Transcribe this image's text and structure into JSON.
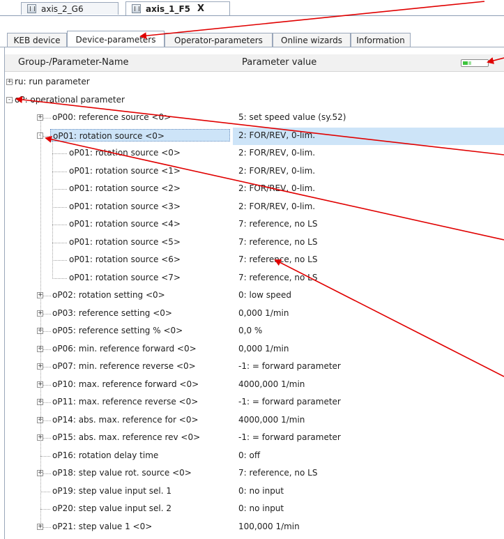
{
  "doc_tabs": [
    {
      "label": "axis_2_G6",
      "active": false
    },
    {
      "label": "axis_1_F5",
      "active": true,
      "close": "X"
    }
  ],
  "sub_tabs": [
    {
      "label": "KEB device",
      "active": false
    },
    {
      "label": "Device-parameters",
      "active": true
    },
    {
      "label": "Operator-parameters",
      "active": false
    },
    {
      "label": "Online wizards",
      "active": false
    },
    {
      "label": "Information",
      "active": false
    }
  ],
  "columns": {
    "name": "Group-/Parameter-Name",
    "value": "Parameter value"
  },
  "rows": [
    {
      "name": "ru: run parameter",
      "value": "",
      "level": 0,
      "expander": "+"
    },
    {
      "name": "oP: operational parameter",
      "value": "",
      "level": 0,
      "expander": "-"
    },
    {
      "name": "oP00: reference source <0>",
      "value": "5: set speed value (sy.52)",
      "level": 1,
      "expander": "+"
    },
    {
      "name": "oP01: rotation source <0>",
      "value": "2: FOR/REV, 0-lim.",
      "level": 1,
      "expander": "-",
      "selected": true
    },
    {
      "name": "oP01: rotation source <0>",
      "value": "2: FOR/REV, 0-lim.",
      "level": 2,
      "expander": ""
    },
    {
      "name": "oP01: rotation source <1>",
      "value": "2: FOR/REV, 0-lim.",
      "level": 2,
      "expander": ""
    },
    {
      "name": "oP01: rotation source <2>",
      "value": "2: FOR/REV, 0-lim.",
      "level": 2,
      "expander": ""
    },
    {
      "name": "oP01: rotation source <3>",
      "value": "2: FOR/REV, 0-lim.",
      "level": 2,
      "expander": ""
    },
    {
      "name": "oP01: rotation source <4>",
      "value": "7: reference, no LS",
      "level": 2,
      "expander": ""
    },
    {
      "name": "oP01: rotation source <5>",
      "value": "7: reference, no LS",
      "level": 2,
      "expander": ""
    },
    {
      "name": "oP01: rotation source <6>",
      "value": "7: reference, no LS",
      "level": 2,
      "expander": ""
    },
    {
      "name": "oP01: rotation source <7>",
      "value": "7: reference, no LS",
      "level": 2,
      "expander": ""
    },
    {
      "name": "oP02: rotation setting <0>",
      "value": "0: low speed",
      "level": 1,
      "expander": "+"
    },
    {
      "name": "oP03: reference setting <0>",
      "value": "0,000 1/min",
      "level": 1,
      "expander": "+"
    },
    {
      "name": "oP05: reference setting % <0>",
      "value": "0,0 %",
      "level": 1,
      "expander": "+"
    },
    {
      "name": "oP06: min. reference forward <0>",
      "value": "0,000 1/min",
      "level": 1,
      "expander": "+"
    },
    {
      "name": "oP07: min. reference reverse <0>",
      "value": "-1: = forward parameter",
      "level": 1,
      "expander": "+"
    },
    {
      "name": "oP10: max. reference forward <0>",
      "value": "4000,000 1/min",
      "level": 1,
      "expander": "+"
    },
    {
      "name": "oP11: max. reference reverse <0>",
      "value": "-1: = forward parameter",
      "level": 1,
      "expander": "+"
    },
    {
      "name": "oP14: abs. max. reference for <0>",
      "value": "4000,000 1/min",
      "level": 1,
      "expander": "+"
    },
    {
      "name": "oP15: abs. max. reference rev <0>",
      "value": "-1: = forward parameter",
      "level": 1,
      "expander": "+"
    },
    {
      "name": "oP16: rotation delay time",
      "value": "0: off",
      "level": 1,
      "expander": ""
    },
    {
      "name": "oP18: step value rot. source <0>",
      "value": "7: reference, no LS",
      "level": 1,
      "expander": "+"
    },
    {
      "name": "oP19: step value input sel. 1",
      "value": "0: no input",
      "level": 1,
      "expander": ""
    },
    {
      "name": "oP20: step value input sel. 2",
      "value": "0: no input",
      "level": 1,
      "expander": ""
    },
    {
      "name": "oP21: step value 1 <0>",
      "value": "100,000 1/min",
      "level": 1,
      "expander": "+"
    }
  ],
  "colors": {
    "selection": "#cde4f8",
    "arrow": "#e00000",
    "toggle_on": "#3dc43d"
  }
}
